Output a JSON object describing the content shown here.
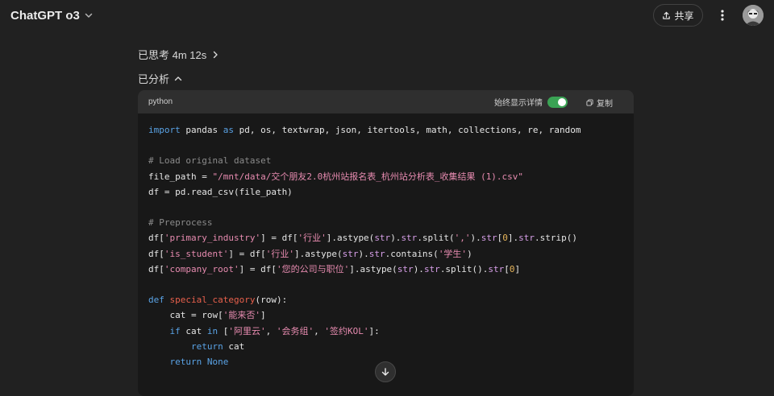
{
  "header": {
    "model_name": "ChatGPT o3",
    "share_label": "共享"
  },
  "thinking": {
    "label": "已思考 4m 12s"
  },
  "analysis": {
    "label": "已分析"
  },
  "code_block": {
    "language": "python",
    "toggle_label": "始终显示详情",
    "toggle_on": true,
    "copy_label": "复制",
    "lines": [
      [
        {
          "t": "import",
          "c": "kw"
        },
        {
          "t": " pandas "
        },
        {
          "t": "as",
          "c": "kw"
        },
        {
          "t": " pd, os, textwrap, json, itertools, math, collections, re, random"
        }
      ],
      [],
      [
        {
          "t": "# Load original dataset",
          "c": "cm"
        }
      ],
      [
        {
          "t": "file_path = "
        },
        {
          "t": "\"/mnt/data/交个朋友2.0杭州站报名表_杭州站分析表_收集结果 (1).csv\"",
          "c": "st"
        }
      ],
      [
        {
          "t": "df = pd.read_csv(file_path)"
        }
      ],
      [],
      [
        {
          "t": "# Preprocess",
          "c": "cm"
        }
      ],
      [
        {
          "t": "df["
        },
        {
          "t": "'primary_industry'",
          "c": "st"
        },
        {
          "t": "] = df["
        },
        {
          "t": "'行业'",
          "c": "st"
        },
        {
          "t": "].astype("
        },
        {
          "t": "str",
          "c": "bi"
        },
        {
          "t": ")."
        },
        {
          "t": "str",
          "c": "bi"
        },
        {
          "t": ".split("
        },
        {
          "t": "','",
          "c": "st"
        },
        {
          "t": ")."
        },
        {
          "t": "str",
          "c": "bi"
        },
        {
          "t": "["
        },
        {
          "t": "0",
          "c": "nm"
        },
        {
          "t": "]."
        },
        {
          "t": "str",
          "c": "bi"
        },
        {
          "t": ".strip()"
        }
      ],
      [
        {
          "t": "df["
        },
        {
          "t": "'is_student'",
          "c": "st"
        },
        {
          "t": "] = df["
        },
        {
          "t": "'行业'",
          "c": "st"
        },
        {
          "t": "].astype("
        },
        {
          "t": "str",
          "c": "bi"
        },
        {
          "t": ")."
        },
        {
          "t": "str",
          "c": "bi"
        },
        {
          "t": ".contains("
        },
        {
          "t": "'学生'",
          "c": "st"
        },
        {
          "t": ")"
        }
      ],
      [
        {
          "t": "df["
        },
        {
          "t": "'company_root'",
          "c": "st"
        },
        {
          "t": "] = df["
        },
        {
          "t": "'您的公司与职位'",
          "c": "st"
        },
        {
          "t": "].astype("
        },
        {
          "t": "str",
          "c": "bi"
        },
        {
          "t": ")."
        },
        {
          "t": "str",
          "c": "bi"
        },
        {
          "t": ".split()."
        },
        {
          "t": "str",
          "c": "bi"
        },
        {
          "t": "["
        },
        {
          "t": "0",
          "c": "nm"
        },
        {
          "t": "]"
        }
      ],
      [],
      [
        {
          "t": "def",
          "c": "kw"
        },
        {
          "t": " "
        },
        {
          "t": "special_category",
          "c": "fn"
        },
        {
          "t": "(row):"
        }
      ],
      [
        {
          "t": "    cat = row["
        },
        {
          "t": "'能来否'",
          "c": "st"
        },
        {
          "t": "]"
        }
      ],
      [
        {
          "t": "    "
        },
        {
          "t": "if",
          "c": "kw"
        },
        {
          "t": " cat "
        },
        {
          "t": "in",
          "c": "kw"
        },
        {
          "t": " ["
        },
        {
          "t": "'阿里云'",
          "c": "st"
        },
        {
          "t": ", "
        },
        {
          "t": "'会务组'",
          "c": "st"
        },
        {
          "t": ", "
        },
        {
          "t": "'签约KOL'",
          "c": "st"
        },
        {
          "t": "]:"
        }
      ],
      [
        {
          "t": "        "
        },
        {
          "t": "return",
          "c": "kw"
        },
        {
          "t": " cat"
        }
      ],
      [
        {
          "t": "    "
        },
        {
          "t": "return",
          "c": "kw"
        },
        {
          "t": " "
        },
        {
          "t": "None",
          "c": "kw"
        }
      ]
    ]
  },
  "colors": {
    "background": "#212121",
    "code_background": "#181818",
    "code_header": "#2f2f2f",
    "toggle_on": "#3aa354"
  },
  "icons": {
    "model_dropdown": "chevron-down-icon",
    "share": "upload-icon",
    "more": "more-vertical-icon",
    "thinking": "chevron-right-icon",
    "analysis": "chevron-up-icon",
    "copy": "copy-icon",
    "scroll": "arrow-down-icon"
  }
}
